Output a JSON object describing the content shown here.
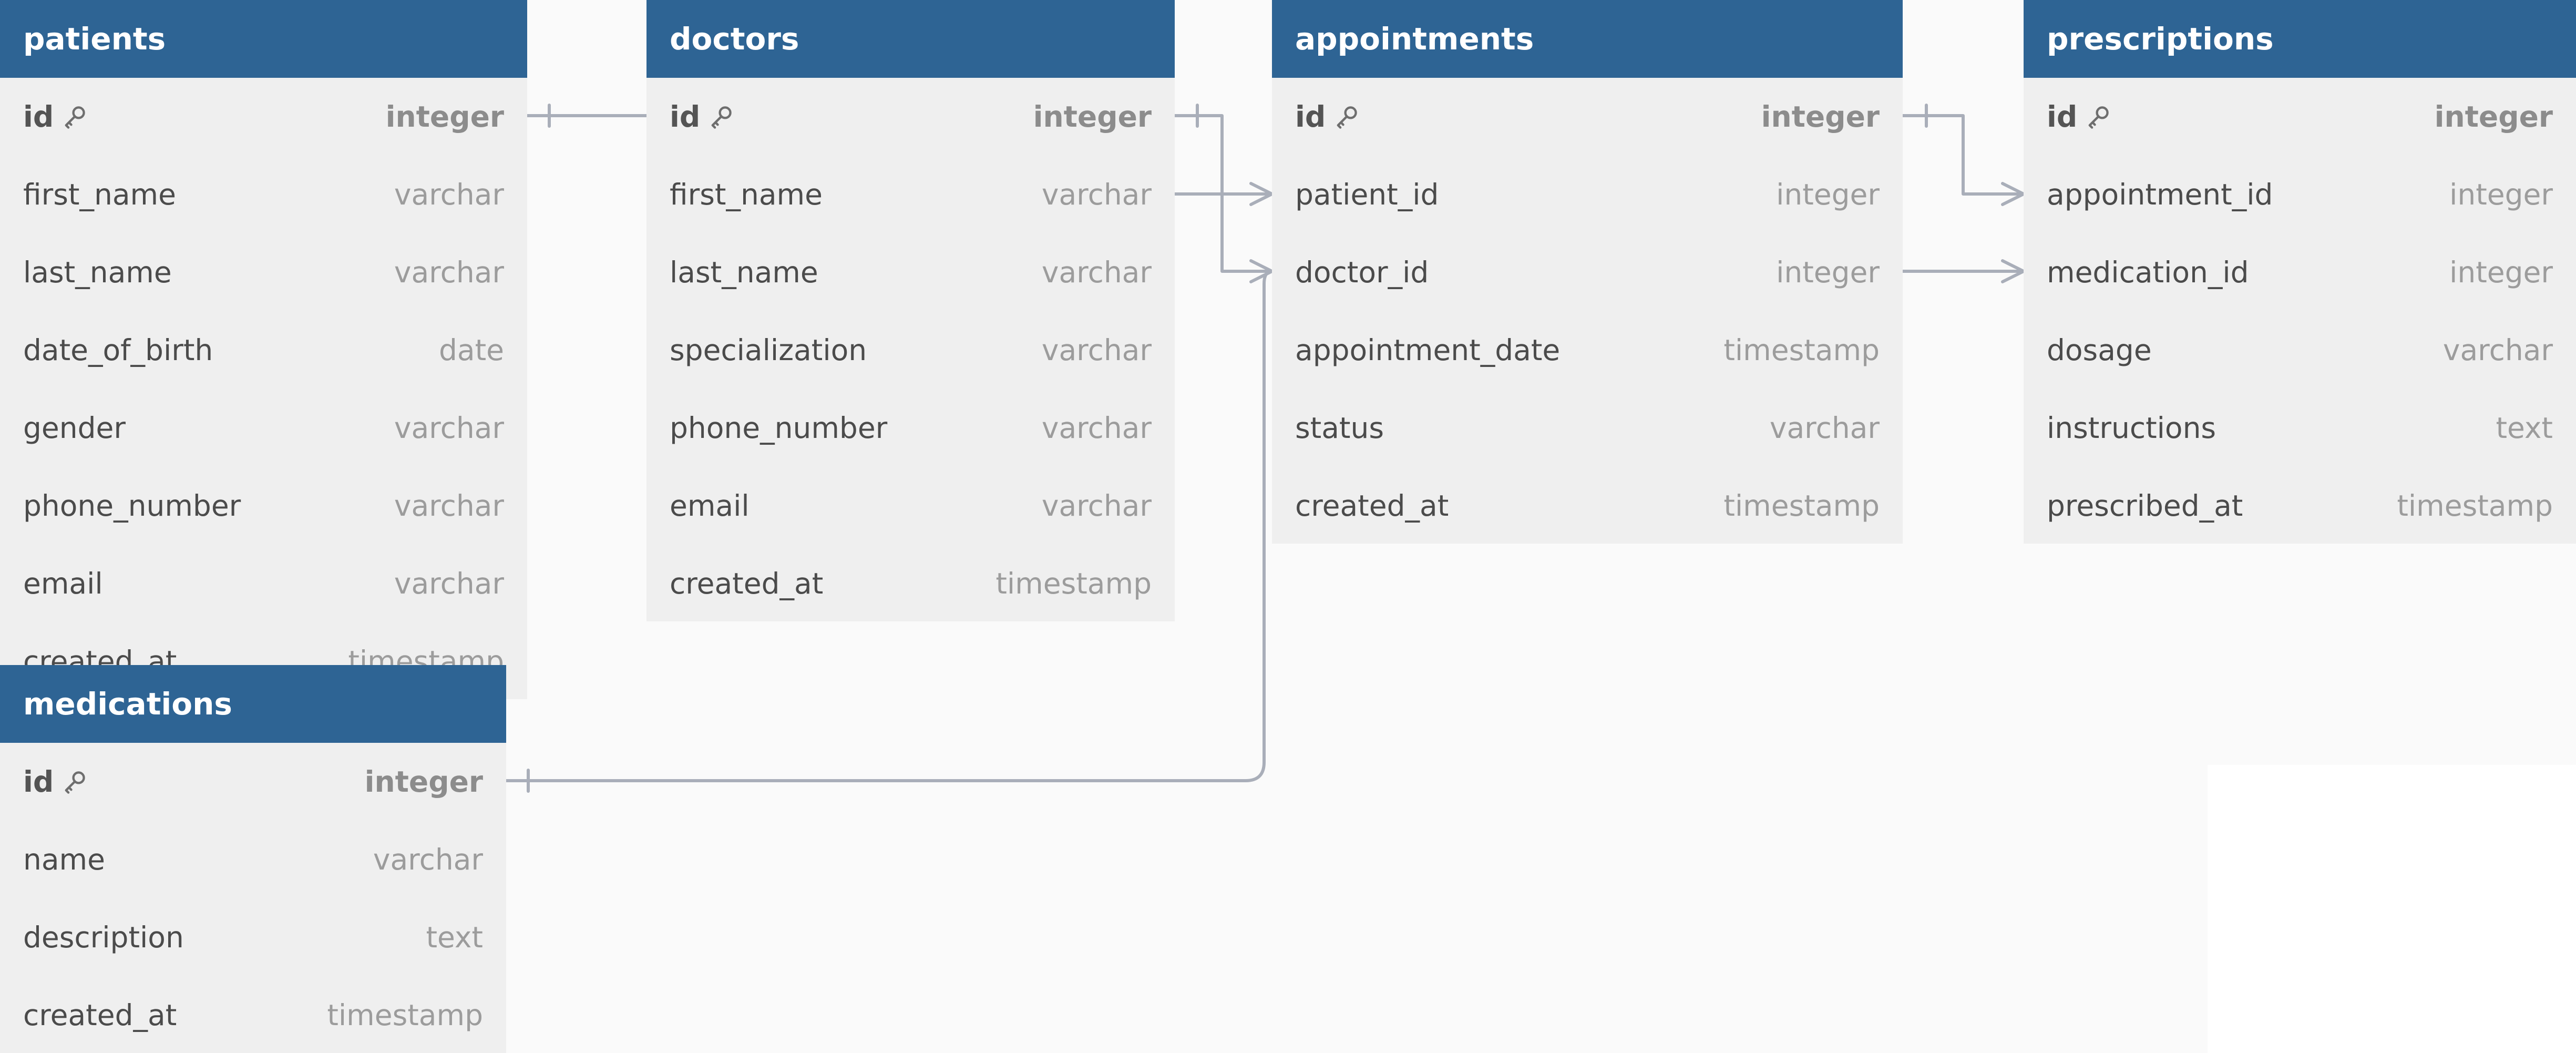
{
  "colors": {
    "header_bg": "#2e6494",
    "header_text": "#ffffff",
    "body_bg": "#efefef",
    "canvas_bg": "#fafafa",
    "connector": "#a9aeb9"
  },
  "tables": {
    "patients": {
      "title": "patients",
      "rows": [
        {
          "name": "id",
          "type": "integer",
          "pk": true
        },
        {
          "name": "first_name",
          "type": "varchar"
        },
        {
          "name": "last_name",
          "type": "varchar"
        },
        {
          "name": "date_of_birth",
          "type": "date"
        },
        {
          "name": "gender",
          "type": "varchar"
        },
        {
          "name": "phone_number",
          "type": "varchar"
        },
        {
          "name": "email",
          "type": "varchar"
        },
        {
          "name": "created_at",
          "type": "timestamp"
        }
      ]
    },
    "doctors": {
      "title": "doctors",
      "rows": [
        {
          "name": "id",
          "type": "integer",
          "pk": true
        },
        {
          "name": "first_name",
          "type": "varchar"
        },
        {
          "name": "last_name",
          "type": "varchar"
        },
        {
          "name": "specialization",
          "type": "varchar"
        },
        {
          "name": "phone_number",
          "type": "varchar"
        },
        {
          "name": "email",
          "type": "varchar"
        },
        {
          "name": "created_at",
          "type": "timestamp"
        }
      ]
    },
    "appointments": {
      "title": "appointments",
      "rows": [
        {
          "name": "id",
          "type": "integer",
          "pk": true
        },
        {
          "name": "patient_id",
          "type": "integer"
        },
        {
          "name": "doctor_id",
          "type": "integer"
        },
        {
          "name": "appointment_date",
          "type": "timestamp"
        },
        {
          "name": "status",
          "type": "varchar"
        },
        {
          "name": "created_at",
          "type": "timestamp"
        }
      ]
    },
    "prescriptions": {
      "title": "prescriptions",
      "rows": [
        {
          "name": "id",
          "type": "integer",
          "pk": true
        },
        {
          "name": "appointment_id",
          "type": "integer"
        },
        {
          "name": "medication_id",
          "type": "integer"
        },
        {
          "name": "dosage",
          "type": "varchar"
        },
        {
          "name": "instructions",
          "type": "text"
        },
        {
          "name": "prescribed_at",
          "type": "timestamp"
        }
      ]
    },
    "medications": {
      "title": "medications",
      "rows": [
        {
          "name": "id",
          "type": "integer",
          "pk": true
        },
        {
          "name": "name",
          "type": "varchar"
        },
        {
          "name": "description",
          "type": "text"
        },
        {
          "name": "created_at",
          "type": "timestamp"
        }
      ]
    }
  },
  "relationships": [
    {
      "from": "patients.id",
      "to": "appointments.patient_id",
      "type": "one-to-many"
    },
    {
      "from": "doctors.id",
      "to": "appointments.doctor_id",
      "type": "one-to-many"
    },
    {
      "from": "appointments.id",
      "to": "prescriptions.appointment_id",
      "type": "one-to-many"
    },
    {
      "from": "medications.id",
      "to": "prescriptions.medication_id",
      "type": "one-to-many"
    }
  ]
}
